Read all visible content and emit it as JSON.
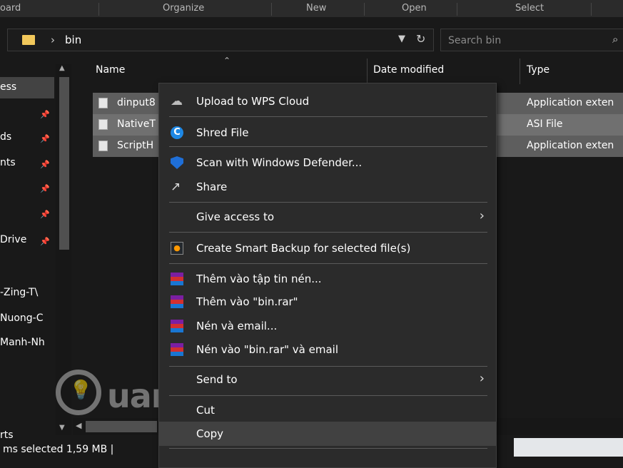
{
  "ribbon": {
    "groups": [
      "oard",
      "Organize",
      "New",
      "Open",
      "Select"
    ]
  },
  "address": {
    "crumb": "bin",
    "search_placeholder": "Search bin"
  },
  "nav": {
    "items": [
      {
        "label": "ess",
        "pinned": false
      },
      {
        "label": "",
        "pinned": true
      },
      {
        "label": "ds",
        "pinned": true
      },
      {
        "label": "nts",
        "pinned": true
      },
      {
        "label": "",
        "pinned": true
      },
      {
        "label": "",
        "pinned": true
      },
      {
        "label": "Drive",
        "pinned": true
      },
      {
        "label": "-Zing-T\\"
      },
      {
        "label": "Nuong-C"
      },
      {
        "label": "Manh-Nh"
      },
      {
        "label": "rts"
      }
    ]
  },
  "columns": {
    "name": "Name",
    "date": "Date modified",
    "type": "Type"
  },
  "files": [
    {
      "name": "dinput8",
      "type": "Application exten"
    },
    {
      "name": "NativeT",
      "type": "ASI File"
    },
    {
      "name": "ScriptH",
      "type": "Application exten"
    }
  ],
  "status": {
    "text": "ms selected  1,59 MB  |"
  },
  "watermark": {
    "text": "uantrimang"
  },
  "context_menu": {
    "upload": "Upload to WPS Cloud",
    "shred": "Shred File",
    "defender": "Scan with Windows Defender...",
    "share": "Share",
    "give_access": "Give access to",
    "backup": "Create Smart Backup for selected file(s)",
    "rar_add": "Thêm vào tập tin nén...",
    "rar_add_bin": "Thêm vào \"bin.rar\"",
    "rar_email": "Nén và email...",
    "rar_bin_email": "Nén vào \"bin.rar\" và email",
    "send_to": "Send to",
    "cut": "Cut",
    "copy": "Copy"
  }
}
